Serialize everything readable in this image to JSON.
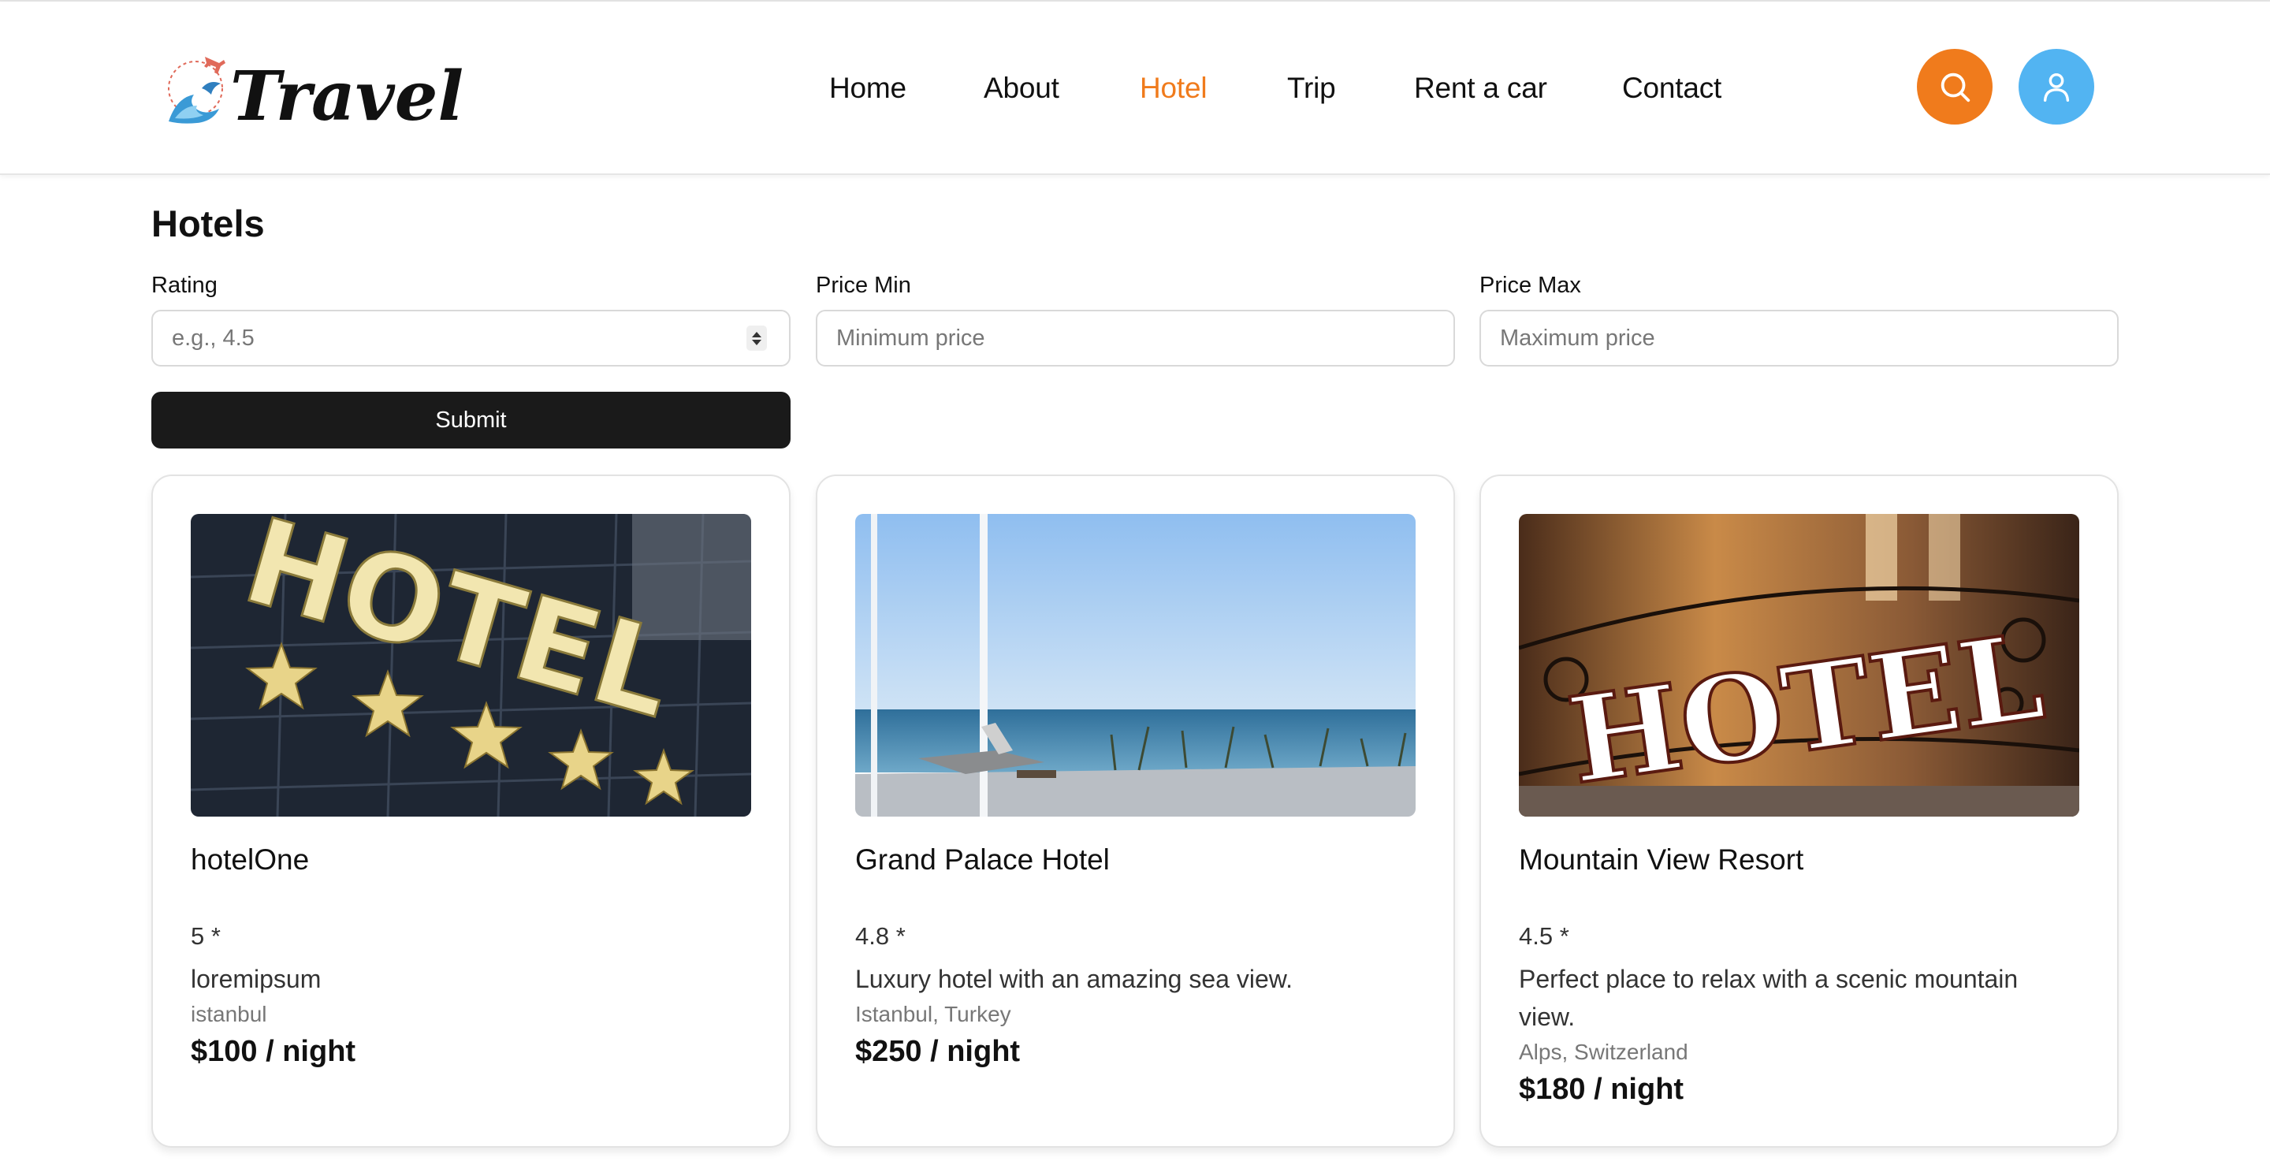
{
  "header": {
    "brand": "Travel",
    "nav": [
      {
        "label": "Home",
        "active": false
      },
      {
        "label": "About",
        "active": false
      },
      {
        "label": "Hotel",
        "active": true
      },
      {
        "label": "Trip",
        "active": false
      },
      {
        "label": "Rent a car",
        "active": false
      },
      {
        "label": "Contact",
        "active": false
      }
    ],
    "actions": [
      {
        "icon": "search-icon",
        "color": "#f07b1c"
      },
      {
        "icon": "user-icon",
        "color": "#52b4f2"
      }
    ]
  },
  "page": {
    "title": "Hotels"
  },
  "filters": {
    "rating": {
      "label": "Rating",
      "placeholder": "e.g., 4.5",
      "value": ""
    },
    "price_min": {
      "label": "Price Min",
      "placeholder": "Minimum price",
      "value": ""
    },
    "price_max": {
      "label": "Price Max",
      "placeholder": "Maximum price",
      "value": ""
    },
    "submit_label": "Submit"
  },
  "hotels": [
    {
      "name": "hotelOne",
      "rating": "5 *",
      "description": "loremipsum",
      "location": "istanbul",
      "price": "$100 / night",
      "image": "hotel-sign-stars-image"
    },
    {
      "name": "Grand Palace Hotel",
      "rating": "4.8 *",
      "description": "Luxury hotel with an amazing sea view.",
      "location": "Istanbul, Turkey",
      "price": "$250 / night",
      "image": "sea-view-terrace-image"
    },
    {
      "name": "Mountain View Resort",
      "rating": "4.5 *",
      "description": "Perfect place to relax with a scenic mountain view.",
      "location": "Alps, Switzerland",
      "price": "$180 / night",
      "image": "hotel-balcony-sign-image"
    }
  ],
  "colors": {
    "accent_orange": "#f07b1c",
    "accent_blue": "#52b4f2",
    "button_dark": "#1a1a1a"
  }
}
